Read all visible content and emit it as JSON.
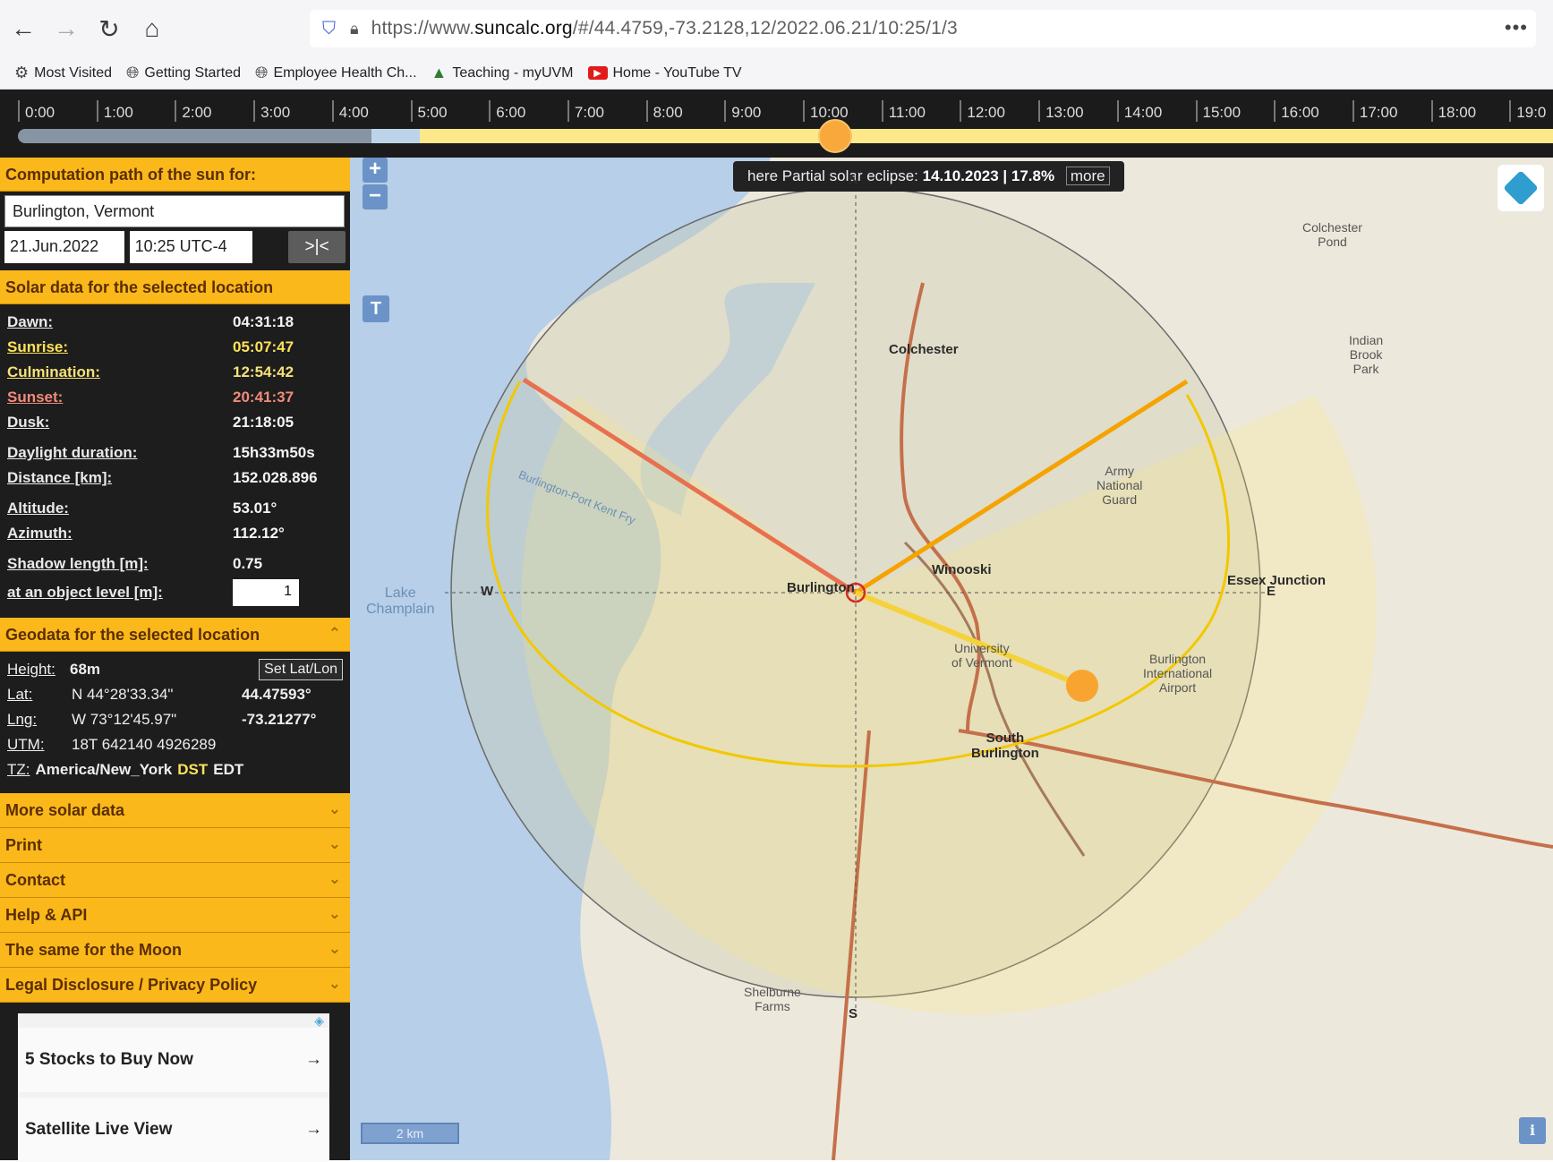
{
  "browser": {
    "url_prefix": "https://www.",
    "url_domain": "suncalc.org",
    "url_path": "/#/44.4759,-73.2128,12/2022.06.21/10:25/1/3",
    "menu": "•••",
    "bookmarks": [
      {
        "label": "Most Visited",
        "icon": "gear-icon"
      },
      {
        "label": "Getting Started",
        "icon": "globe-icon"
      },
      {
        "label": "Employee Health Ch...",
        "icon": "globe-icon"
      },
      {
        "label": "Teaching - myUVM",
        "icon": "tree-icon"
      },
      {
        "label": "Home - YouTube TV",
        "icon": "youtube-icon"
      }
    ]
  },
  "timeline": {
    "hours": [
      "0:00",
      "1:00",
      "2:00",
      "3:00",
      "4:00",
      "5:00",
      "6:00",
      "7:00",
      "8:00",
      "9:00",
      "10:00",
      "11:00",
      "12:00",
      "13:00",
      "14:00",
      "15:00",
      "16:00",
      "17:00",
      "18:00",
      "19:0"
    ],
    "current_time_fraction": 0.434
  },
  "sidebar": {
    "computation_header": "Computation path of the sun for:",
    "location": "Burlington, Vermont",
    "date": "21.Jun.2022",
    "time": "10:25 UTC-4",
    "now_button": ">|<",
    "solar_header": "Solar data for the selected location",
    "solar": {
      "dawn_k": "Dawn:",
      "dawn_v": "04:31:18",
      "sunrise_k": "Sunrise:",
      "sunrise_v": "05:07:47",
      "culmination_k": "Culmination:",
      "culmination_v": "12:54:42",
      "sunset_k": "Sunset:",
      "sunset_v": "20:41:37",
      "dusk_k": "Dusk:",
      "dusk_v": "21:18:05",
      "daylight_k": "Daylight duration:",
      "daylight_v": "15h33m50s",
      "distance_k": "Distance [km]:",
      "distance_v": "152.028.896",
      "altitude_k": "Altitude:",
      "altitude_v": "53.01°",
      "azimuth_k": "Azimuth:",
      "azimuth_v": "112.12°",
      "shadow_k": "Shadow length [m]:",
      "shadow_v": "0.75",
      "level_k": "at an object level [m]:",
      "level_v": "1"
    },
    "geo_header": "Geodata for the selected location",
    "geo": {
      "height_k": "Height:",
      "height_v": "68m",
      "setlatlon": "Set Lat/Lon",
      "lat_k": "Lat:",
      "lat_dms": "N 44°28'33.34\"",
      "lat_dec": "44.47593°",
      "lng_k": "Lng:",
      "lng_dms": "W 73°12'45.97\"",
      "lng_dec": "-73.21277°",
      "utm_k": "UTM:",
      "utm_v": "18T 642140 4926289",
      "tz_k": "TZ:",
      "tz_v": "America/New_York",
      "tz_dst": "DST",
      "tz_abbr": "EDT"
    },
    "menu": [
      "More solar data",
      "Print",
      "Contact",
      "Help & API",
      "The same for the Moon",
      "Legal Disclosure / Privacy Policy"
    ],
    "ads": [
      "5 Stocks to Buy Now",
      "Satellite Live View"
    ]
  },
  "map": {
    "zoom_in": "+",
    "zoom_out": "−",
    "t_button": "T",
    "eclipse_prefix": "here Partial solar eclipse:",
    "eclipse_date": "14.10.2023 | 17.8%",
    "eclipse_more": "more",
    "scale": "2 km",
    "info": "i",
    "compass": {
      "n": "N",
      "s": "S",
      "e": "E",
      "w": "W"
    },
    "places": {
      "colchester": "Colchester",
      "winooski": "Winooski",
      "burlington": "Burlington",
      "south_burlington": "South\nBurlington",
      "essex": "Essex Junction",
      "lake": "Lake\nChamplain",
      "army": "Army\nNational\nGuard",
      "airport": "Burlington\nInternational\nAirport",
      "indian": "Indian\nBrook\nPark",
      "colchester_pond": "Colchester\nPond",
      "ferry": "Burlington-Port Kent Fry",
      "shelburne": "Shelburne\nFarms",
      "uvm": "University\nof Vermont"
    }
  }
}
